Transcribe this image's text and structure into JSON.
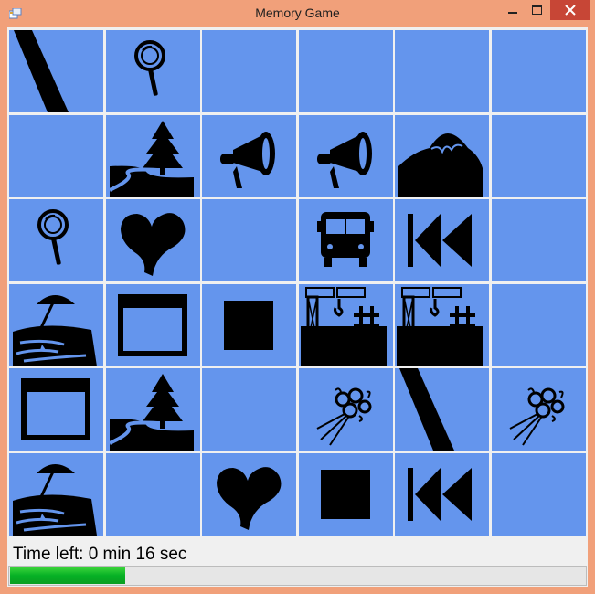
{
  "window": {
    "title": "Memory Game",
    "frame_color": "#f1a07a",
    "close_color": "#c74636"
  },
  "board": {
    "tile_color": "#6495ed",
    "rows": 6,
    "columns": 6,
    "tiles": [
      [
        "slash-icon",
        "magnifier-icon",
        "",
        "",
        "",
        ""
      ],
      [
        "",
        "tree-river-icon",
        "megaphone-icon",
        "megaphone-icon",
        "mountain-icon",
        ""
      ],
      [
        "magnifier-icon",
        "heart-icon",
        "",
        "bus-icon",
        "rewind-icon",
        ""
      ],
      [
        "beach-icon",
        "window-frame-icon",
        "square-icon",
        "crane-icon",
        "crane-icon",
        ""
      ],
      [
        "window-frame-icon",
        "tree-river-icon",
        "",
        "flower-bouquet-icon",
        "slash-icon",
        "flower-bouquet-icon"
      ],
      [
        "beach-icon",
        "",
        "heart-icon",
        "square-icon",
        "rewind-icon",
        ""
      ]
    ]
  },
  "status": {
    "time_left_text": "Time left: 0 min 16 sec"
  },
  "progress": {
    "fraction": 0.2,
    "color": "#06b025"
  }
}
